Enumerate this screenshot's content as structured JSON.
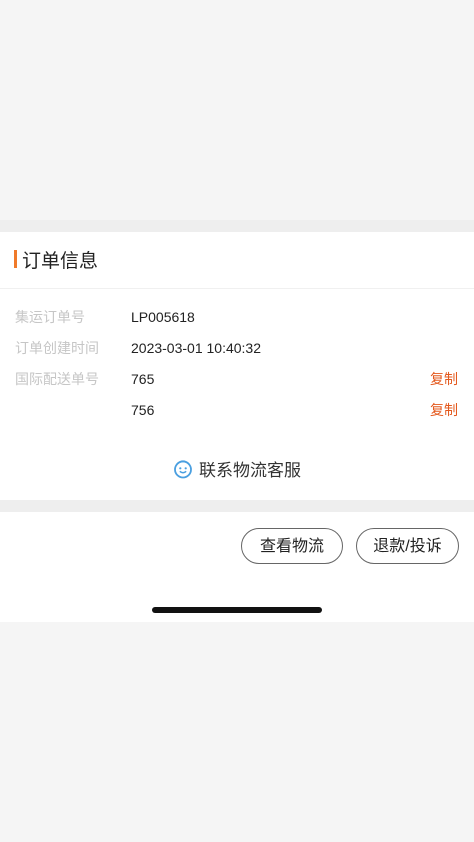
{
  "order_info": {
    "title": "订单信息",
    "rows": [
      {
        "label": "集运订单号",
        "value": "LP005618"
      },
      {
        "label": "订单创建时间",
        "value": "2023-03-01 10:40:32"
      },
      {
        "label": "国际配送单号",
        "value": "765",
        "copy_label": "复制"
      },
      {
        "label": "",
        "value": "756",
        "copy_label": "复制"
      }
    ],
    "contact_label": "联系物流客服"
  },
  "actions": {
    "view_logistics": "查看物流",
    "refund_complaint": "退款/投诉"
  },
  "colors": {
    "accent": "#f07a2a",
    "copy_link": "#e4581c",
    "contact_icon": "#4a9fe0"
  },
  "icons": {
    "contact": "smiley-service-icon"
  }
}
